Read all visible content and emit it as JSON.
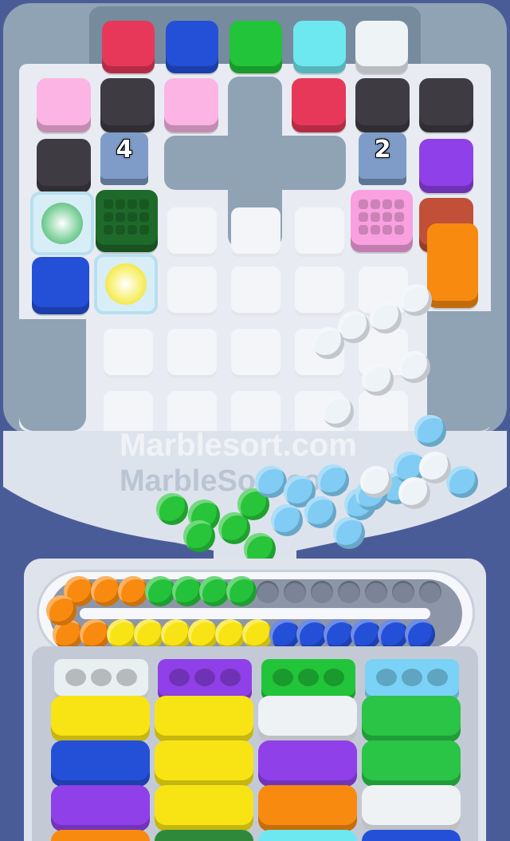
{
  "game": {
    "title": "Marble Sort",
    "watermark_main": "Marblesort.com",
    "watermark_faint": "MarbleSort.com"
  },
  "colors": {
    "red": "#e8385a",
    "blue": "#2450d8",
    "green": "#22c43a",
    "cyan": "#6ee8f0",
    "white": "#eef3f6",
    "pink": "#fcb4e4",
    "dark": "#3e3c42",
    "purple": "#9040e8",
    "brown": "#c05038",
    "orange": "#f88a10",
    "yellow": "#f8e414",
    "darkgreen": "#1e6a2a",
    "hotpink": "#f8a0e0",
    "lightblue": "#80ccf4"
  },
  "counters": {
    "left_tag": "4",
    "right_tag": "2"
  },
  "board": {
    "top_row": [
      "red",
      "blue",
      "green",
      "cyan",
      "white"
    ],
    "row2": [
      "pink",
      "dark",
      "pink",
      "empty",
      "red",
      "dark",
      "dark"
    ],
    "row3": [
      "dark",
      "tag",
      "plus",
      "plus",
      "plus",
      "tag",
      "purple"
    ],
    "row4": [
      "ice-green",
      "darkgreen-grid",
      "slot",
      "slot",
      "slot",
      "hotpink-grid",
      "brown"
    ],
    "row5": [
      "blue",
      "ice-yellow",
      "slot",
      "slot",
      "slot",
      "slot",
      "orange"
    ]
  },
  "funnel_marbles": {
    "green": 6,
    "lightblue": 12,
    "white": 10
  },
  "conveyor": {
    "outer_lane": [
      "orange",
      "orange",
      "orange",
      "green",
      "green",
      "green",
      "green",
      "empty",
      "empty",
      "empty",
      "empty",
      "empty",
      "empty",
      "empty"
    ],
    "inner_lane": [
      "orange",
      "orange",
      "yellow",
      "yellow",
      "yellow",
      "yellow",
      "yellow",
      "yellow",
      "blue",
      "blue",
      "blue",
      "blue",
      "blue",
      "blue"
    ]
  },
  "columns": [
    {
      "cap": "white",
      "blocks": [
        "yellow",
        "blue",
        "purple"
      ]
    },
    {
      "cap": "purple",
      "blocks": [
        "yellow",
        "yellow",
        "yellow"
      ]
    },
    {
      "cap": "green",
      "blocks": [
        "white",
        "purple",
        "orange"
      ]
    },
    {
      "cap": "lightblue",
      "blocks": [
        "green",
        "green",
        "white"
      ]
    }
  ]
}
